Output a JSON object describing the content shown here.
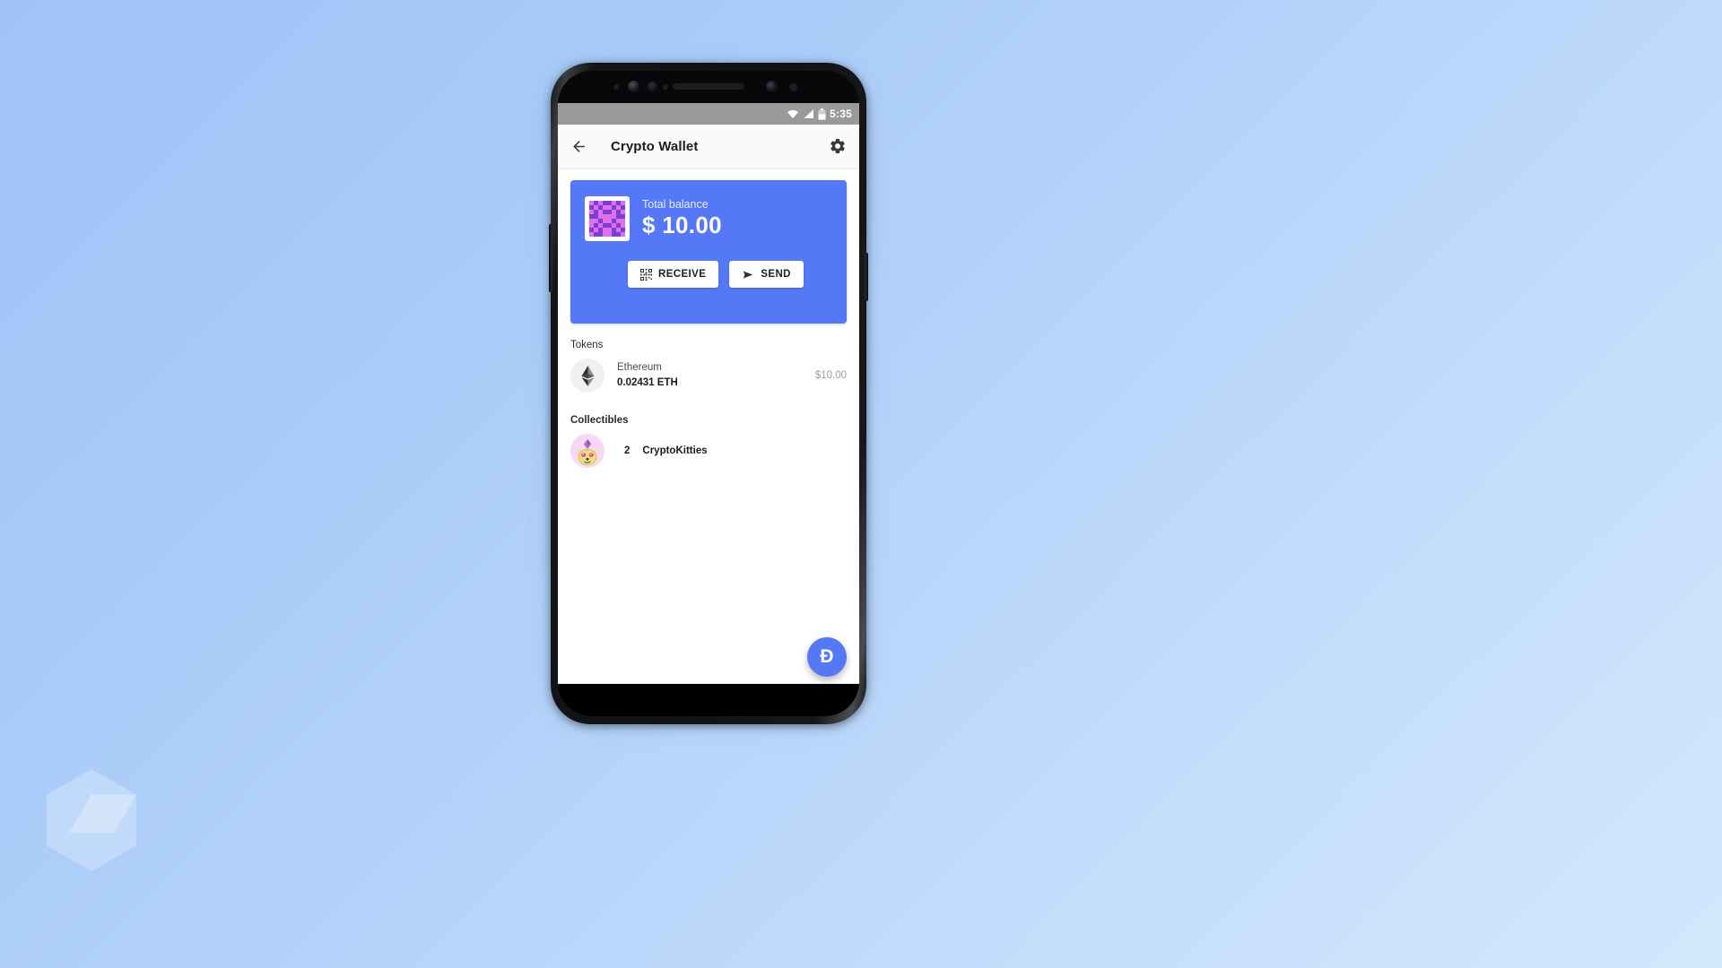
{
  "background": {
    "color_top_left": "#9fc3f7",
    "color_bottom_right": "#d3e7fc"
  },
  "watermark": {
    "name": "hexagon-cube-logo"
  },
  "device": {
    "name": "android-phone",
    "sensors": [
      "proximity-sensor",
      "iris-scanner",
      "front-camera",
      "earpiece-speaker"
    ],
    "power_button": "power-button",
    "volume_button": "volume-button"
  },
  "statusbar": {
    "time": "5:35",
    "icons": [
      "wifi-icon",
      "signal-icon",
      "battery-icon"
    ]
  },
  "appbar": {
    "back_icon": "back-arrow-icon",
    "title": "Crypto Wallet",
    "settings_icon": "gear-icon"
  },
  "balance_card": {
    "accent_color": "#5578f7",
    "avatar": "identicon-avatar",
    "label": "Total balance",
    "amount": "$ 10.00",
    "actions": [
      {
        "label": "RECEIVE",
        "icon": "qr-code-icon"
      },
      {
        "label": "SEND",
        "icon": "paper-plane-icon"
      }
    ]
  },
  "tokens": {
    "title": "Tokens",
    "items": [
      {
        "icon": "ethereum-icon",
        "name": "Ethereum",
        "amount": "0.02431 ETH",
        "fiat": "$10.00"
      }
    ]
  },
  "collectibles": {
    "title": "Collectibles",
    "items": [
      {
        "icon": "cryptokitty-icon",
        "count": "2",
        "name": "CryptoKitties"
      }
    ]
  },
  "fab": {
    "label": "Ð",
    "name": "dapp-browser-fab",
    "color": "#5578f7"
  },
  "navbar": {
    "buttons": [
      "back-nav-button",
      "home-nav-button",
      "recents-nav-button"
    ]
  }
}
